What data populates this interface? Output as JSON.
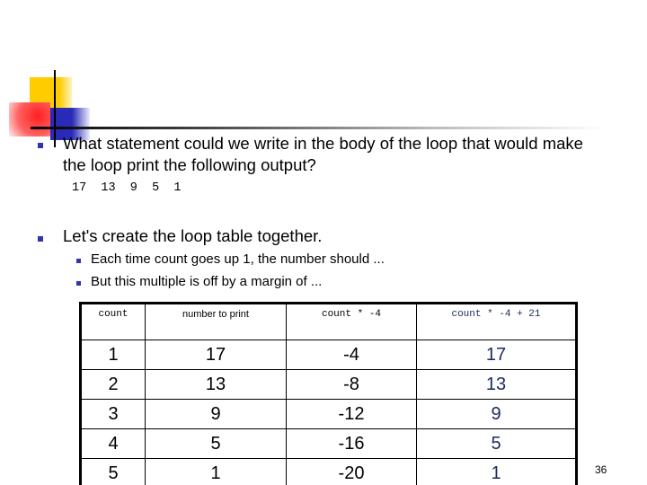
{
  "bullets": [
    {
      "text": "What statement could we write in the body of the loop that would make the loop print the following output?"
    },
    {
      "text": "Let's create the loop table together."
    }
  ],
  "output_line": "17  13  9  5  1",
  "sub_bullets": [
    {
      "text": "Each time count goes up 1, the number should ..."
    },
    {
      "text": "But this multiple is off by a margin of ..."
    }
  ],
  "table": {
    "headers": [
      "count",
      "number to print",
      "count * -4",
      "count * -4 + 21"
    ],
    "rows": [
      [
        "1",
        "17",
        "-4",
        "17"
      ],
      [
        "2",
        "13",
        "-8",
        "13"
      ],
      [
        "3",
        "9",
        "-12",
        "9"
      ],
      [
        "4",
        "5",
        "-16",
        "5"
      ],
      [
        "5",
        "1",
        "-20",
        "1"
      ]
    ]
  },
  "page_number": "36",
  "colors": {
    "bullet": "#3333aa",
    "accent_yellow": "#ffcc00",
    "accent_red": "#ff2020",
    "accent_blue": "#2a2ab8",
    "last_column_text": "#1a2a5a"
  }
}
